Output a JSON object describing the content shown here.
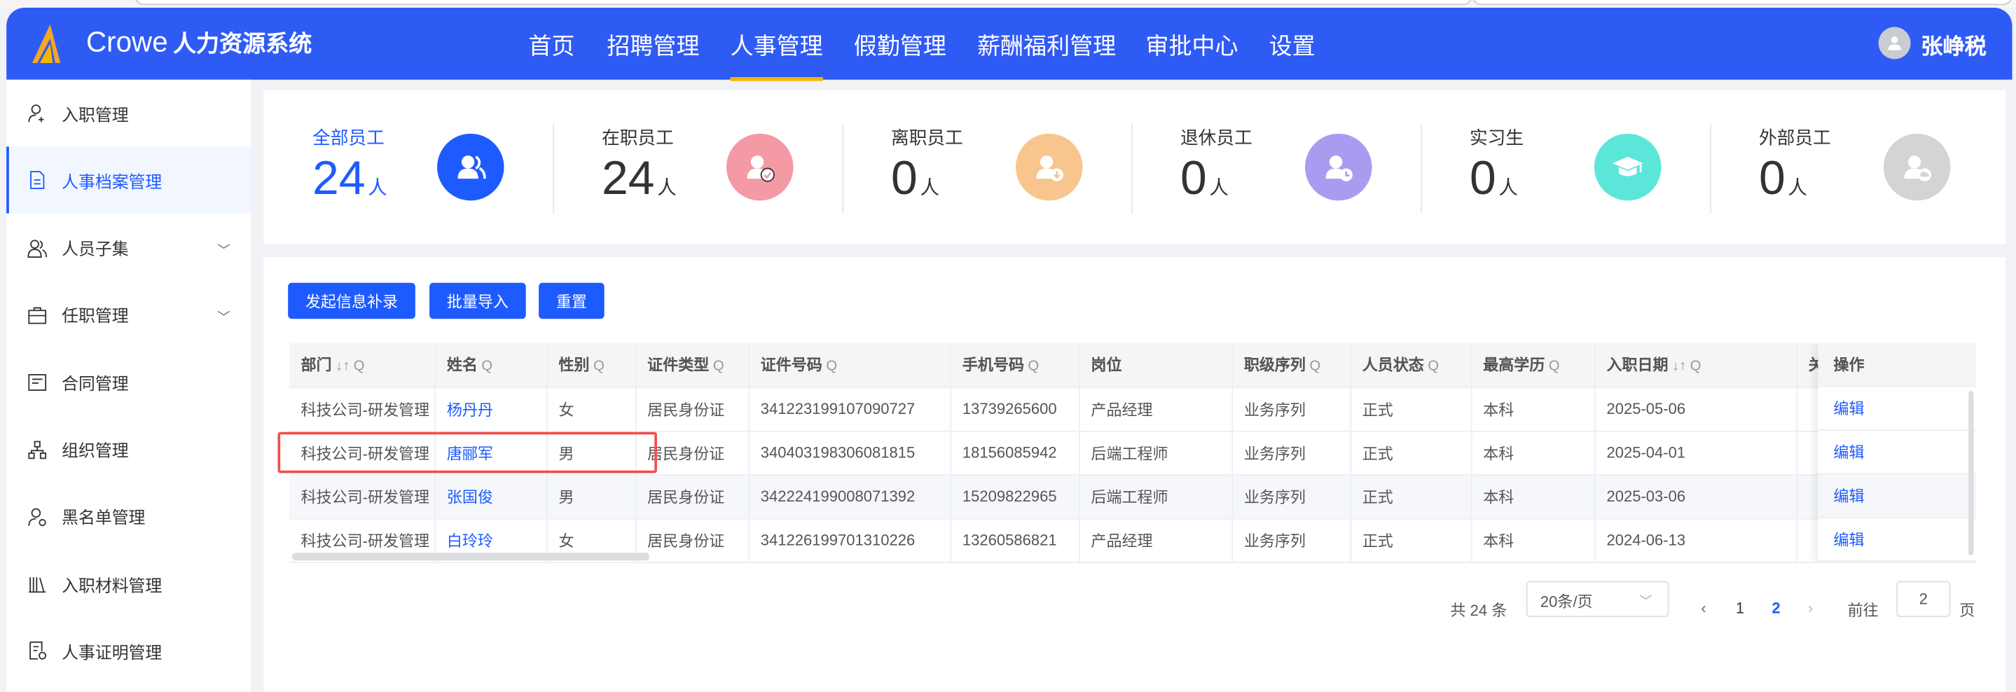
{
  "header": {
    "brand": "Crowe",
    "system_name": "人力资源系统",
    "nav": [
      "首页",
      "招聘管理",
      "人事管理",
      "假勤管理",
      "薪酬福利管理",
      "审批中心",
      "设置"
    ],
    "active_nav": "人事管理",
    "user_name": "张峥税"
  },
  "sidebar": {
    "items": [
      {
        "label": "入职管理",
        "icon": "user-add-icon"
      },
      {
        "label": "人事档案管理",
        "icon": "document-icon",
        "active": true
      },
      {
        "label": "人员子集",
        "icon": "users-icon",
        "expandable": true
      },
      {
        "label": "任职管理",
        "icon": "briefcase-icon",
        "expandable": true
      },
      {
        "label": "合同管理",
        "icon": "contract-icon"
      },
      {
        "label": "组织管理",
        "icon": "org-icon"
      },
      {
        "label": "黑名单管理",
        "icon": "user-block-icon"
      },
      {
        "label": "入职材料管理",
        "icon": "books-icon"
      },
      {
        "label": "人事证明管理",
        "icon": "certificate-icon"
      }
    ]
  },
  "stats": [
    {
      "label": "全部员工",
      "value": "24",
      "unit": "人",
      "color": "#1e5bff"
    },
    {
      "label": "在职员工",
      "value": "24",
      "unit": "人",
      "color": "#f49aa5"
    },
    {
      "label": "离职员工",
      "value": "0",
      "unit": "人",
      "color": "#f8c58e"
    },
    {
      "label": "退休员工",
      "value": "0",
      "unit": "人",
      "color": "#a99cf0"
    },
    {
      "label": "实习生",
      "value": "0",
      "unit": "人",
      "color": "#5ce6da"
    },
    {
      "label": "外部员工",
      "value": "0",
      "unit": "人",
      "color": "#d4d4d4"
    }
  ],
  "toolbar": {
    "supplement": "发起信息补录",
    "import": "批量导入",
    "reset": "重置"
  },
  "table": {
    "columns": [
      "部门",
      "姓名",
      "性别",
      "证件类型",
      "证件号码",
      "手机号码",
      "岗位",
      "职级序列",
      "人员状态",
      "最高学历",
      "入职日期",
      "关"
    ],
    "action_header": "操作",
    "action_label": "编辑",
    "rows": [
      [
        "科技公司-研发管理",
        "杨丹丹",
        "女",
        "居民身份证",
        "341223199107090727",
        "13739265600",
        "产品经理",
        "业务序列",
        "正式",
        "本科",
        "2025-05-06",
        ""
      ],
      [
        "科技公司-研发管理",
        "唐郦军",
        "男",
        "居民身份证",
        "340403198306081815",
        "18156085942",
        "后端工程师",
        "业务序列",
        "正式",
        "本科",
        "2025-04-01",
        ""
      ],
      [
        "科技公司-研发管理",
        "张国俊",
        "男",
        "居民身份证",
        "342224199008071392",
        "15209822965",
        "后端工程师",
        "业务序列",
        "正式",
        "本科",
        "2025-03-06",
        ""
      ],
      [
        "科技公司-研发管理",
        "白玲玲",
        "女",
        "居民身份证",
        "341226199701310226",
        "13260586821",
        "产品经理",
        "业务序列",
        "正式",
        "本科",
        "2024-06-13",
        ""
      ]
    ]
  },
  "pagination": {
    "total": "共 24 条",
    "page_size": "20条/页",
    "pages": [
      "1",
      "2"
    ],
    "current": "2",
    "goto_label": "前往",
    "goto_value": "2",
    "page_suffix": "页"
  }
}
